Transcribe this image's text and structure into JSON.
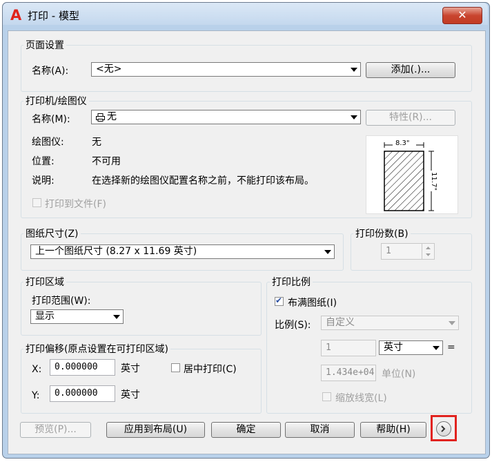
{
  "window": {
    "title": "打印 - 模型",
    "close_label": "✕",
    "app_icon_letter": "A"
  },
  "page_setup": {
    "group_label": "页面设置",
    "name_label": "名称(A):",
    "name_value": "<无>",
    "add_button": "添加(.)..."
  },
  "printer": {
    "group_label": "打印机/绘图仪",
    "name_label": "名称(M):",
    "name_value": "无",
    "properties_button": "特性(R)...",
    "plotter_label": "绘图仪:",
    "plotter_value": "无",
    "location_label": "位置:",
    "location_value": "不可用",
    "description_label": "说明:",
    "description_value": "在选择新的绘图仪配置名称之前，不能打印该布局。",
    "print_to_file_label": "打印到文件(F)",
    "preview_width": "8.3\"",
    "preview_height": "11.7\""
  },
  "paper_size": {
    "group_label": "图纸尺寸(Z)",
    "value": "上一个图纸尺寸 (8.27 x 11.69 英寸)"
  },
  "copies": {
    "group_label": "打印份数(B)",
    "value": "1"
  },
  "plot_area": {
    "group_label": "打印区域",
    "range_label": "打印范围(W):",
    "range_value": "显示"
  },
  "plot_offset": {
    "group_label": "打印偏移(原点设置在可打印区域)",
    "x_label": "X:",
    "x_value": "0.000000",
    "x_unit": "英寸",
    "y_label": "Y:",
    "y_value": "0.000000",
    "y_unit": "英寸",
    "center_label": "居中打印(C)"
  },
  "plot_scale": {
    "group_label": "打印比例",
    "fit_label": "布满图纸(I)",
    "fit_checked": true,
    "scale_label": "比例(S):",
    "scale_value": "自定义",
    "num_value": "1",
    "unit_value": "英寸",
    "equals": "=",
    "den_value": "1.434e+04",
    "den_unit": "单位(N)",
    "lineweights_label": "缩放线宽(L)"
  },
  "footer": {
    "preview_button": "预览(P)...",
    "apply_button": "应用到布局(U)",
    "ok_button": "确定",
    "cancel_button": "取消",
    "help_button": "帮助(H)",
    "expand_icon": "expand-icon"
  },
  "colors": {
    "highlight": "#e1231f",
    "brand": "#e0231c"
  }
}
